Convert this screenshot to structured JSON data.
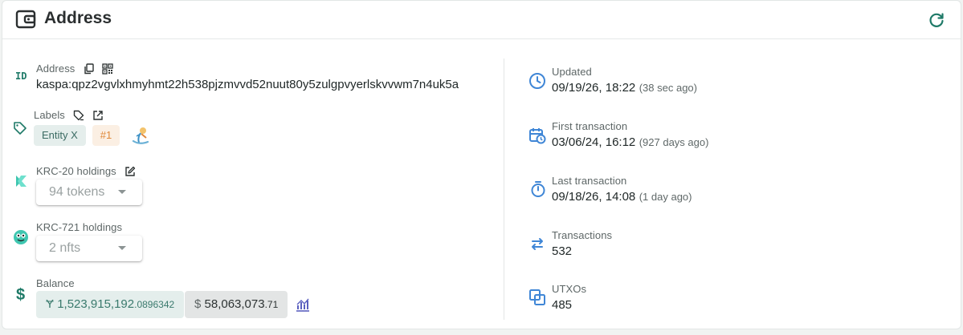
{
  "header": {
    "title": "Address",
    "icon": "wallet-icon",
    "refresh_icon": "refresh-icon"
  },
  "address": {
    "label": "Address",
    "value": "kaspa:qpz2vgvlxhmyhmt22h538pjzmvvd52nuut80y5zulgpvyerlskvvwm7n4uk5a",
    "side_icon_text": "ID"
  },
  "labels": {
    "label": "Labels",
    "chips": [
      "Entity X",
      "#1"
    ]
  },
  "krc20": {
    "label": "KRC-20 holdings",
    "select_value": "94 tokens"
  },
  "krc721": {
    "label": "KRC-721 holdings",
    "select_value": "2 nfts"
  },
  "balance": {
    "label": "Balance",
    "kas_symbol": "Ɏ",
    "kas_main": "1,523,915,192",
    "kas_decimals": ".0896342",
    "usd_symbol": "$",
    "usd_main": "58,063,073",
    "usd_decimals": ".71"
  },
  "right": {
    "updated": {
      "label": "Updated",
      "value": "09/19/26, 18:22",
      "ago": "(38 sec ago)"
    },
    "first_tx": {
      "label": "First transaction",
      "value": "03/06/24, 16:12",
      "ago": "(927 days ago)"
    },
    "last_tx": {
      "label": "Last transaction",
      "value": "09/18/26, 14:08",
      "ago": "(1 day ago)"
    },
    "transactions": {
      "label": "Transactions",
      "value": "532"
    },
    "utxos": {
      "label": "UTXOs",
      "value": "485"
    }
  },
  "colors": {
    "accent": "#1f8a76",
    "blue": "#3f86d6",
    "kas_chip": "#e4eeec",
    "usd_chip": "#e3e5e5"
  }
}
